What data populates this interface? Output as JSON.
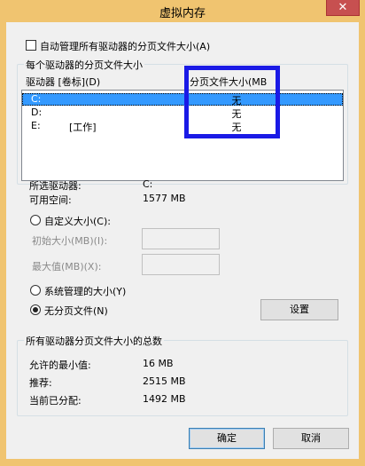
{
  "window": {
    "title": "虚拟内存",
    "close_glyph": "✕"
  },
  "auto_manage": {
    "label": "自动管理所有驱动器的分页文件大小(A)",
    "checked": false
  },
  "drive_group": {
    "legend": "每个驱动器的分页文件大小",
    "header_drive": "驱动器 [卷标](D)",
    "header_size": "分页文件大小(MB",
    "rows": [
      {
        "drive": "C:",
        "label": "",
        "size": "无",
        "selected": true
      },
      {
        "drive": "D:",
        "label": "",
        "size": "无",
        "selected": false
      },
      {
        "drive": "E:",
        "label": "[工作]",
        "size": "无",
        "selected": false
      }
    ]
  },
  "selected_info": {
    "drive_label": "所选驱动器:",
    "drive_value": "C:",
    "space_label": "可用空间:",
    "space_value": "1577 MB"
  },
  "options": {
    "custom_label": "自定义大小(C):",
    "initial_label": "初始大小(MB)(I):",
    "initial_value": "",
    "max_label": "最大值(MB)(X):",
    "max_value": "",
    "system_label": "系统管理的大小(Y)",
    "none_label": "无分页文件(N)",
    "selected": "none",
    "set_button": "设置"
  },
  "totals_group": {
    "legend": "所有驱动器分页文件大小的总数",
    "min_label": "允许的最小值:",
    "min_value": "16 MB",
    "rec_label": "推荐:",
    "rec_value": "2515 MB",
    "cur_label": "当前已分配:",
    "cur_value": "1492 MB"
  },
  "buttons": {
    "ok": "确定",
    "cancel": "取消"
  },
  "colors": {
    "frame": "#f0c470",
    "selection": "#3399ff",
    "highlight_box": "#1a1ae6",
    "close": "#c75050"
  }
}
